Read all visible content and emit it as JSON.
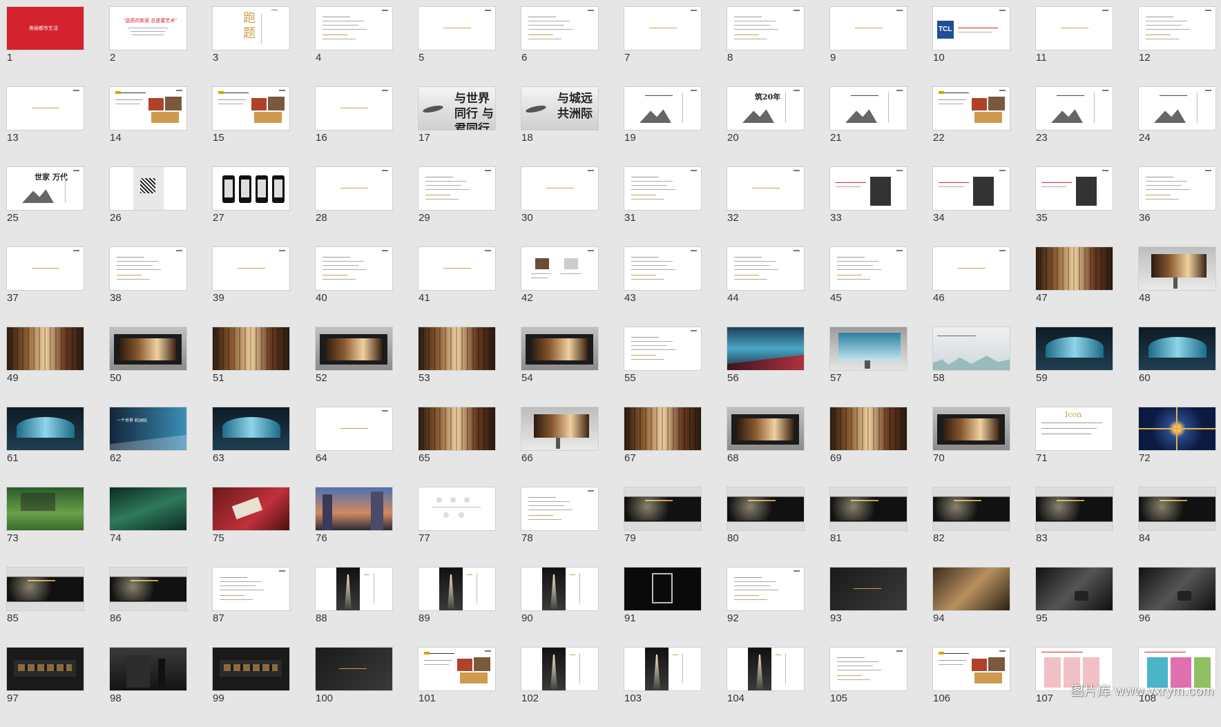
{
  "slides": [
    {
      "n": "1",
      "t": "red",
      "txt": "美丽都市生活"
    },
    {
      "n": "2",
      "t": "quote",
      "txt": "\"品质的新家 总是要艺术\""
    },
    {
      "n": "3",
      "t": "title",
      "txt": "跑 题"
    },
    {
      "n": "4",
      "t": "text"
    },
    {
      "n": "5",
      "t": "gold"
    },
    {
      "n": "6",
      "t": "text"
    },
    {
      "n": "7",
      "t": "gold"
    },
    {
      "n": "8",
      "t": "text"
    },
    {
      "n": "9",
      "t": "gold"
    },
    {
      "n": "10",
      "t": "tcl",
      "txt": "TCL"
    },
    {
      "n": "11",
      "t": "gold"
    },
    {
      "n": "12",
      "t": "text"
    },
    {
      "n": "13",
      "t": "gold"
    },
    {
      "n": "14",
      "t": "photos"
    },
    {
      "n": "15",
      "t": "photos"
    },
    {
      "n": "16",
      "t": "gold"
    },
    {
      "n": "17",
      "t": "ink",
      "txt": "与世界同行 与君同行"
    },
    {
      "n": "18",
      "t": "ink",
      "txt": "与城远 共洲际"
    },
    {
      "n": "19",
      "t": "mtn"
    },
    {
      "n": "20",
      "t": "mtn",
      "txt": "筑20年"
    },
    {
      "n": "21",
      "t": "mtn"
    },
    {
      "n": "22",
      "t": "photos"
    },
    {
      "n": "23",
      "t": "mtn"
    },
    {
      "n": "24",
      "t": "mtn"
    },
    {
      "n": "25",
      "t": "mtn",
      "txt": "世家 万代"
    },
    {
      "n": "26",
      "t": "qr"
    },
    {
      "n": "27",
      "t": "phones"
    },
    {
      "n": "28",
      "t": "gold"
    },
    {
      "n": "29",
      "t": "text"
    },
    {
      "n": "30",
      "t": "gold"
    },
    {
      "n": "31",
      "t": "text"
    },
    {
      "n": "32",
      "t": "gold"
    },
    {
      "n": "33",
      "t": "portrait"
    },
    {
      "n": "34",
      "t": "portrait"
    },
    {
      "n": "35",
      "t": "portrait"
    },
    {
      "n": "36",
      "t": "text"
    },
    {
      "n": "37",
      "t": "gold"
    },
    {
      "n": "38",
      "t": "text"
    },
    {
      "n": "39",
      "t": "gold"
    },
    {
      "n": "40",
      "t": "text"
    },
    {
      "n": "41",
      "t": "gold"
    },
    {
      "n": "42",
      "t": "people"
    },
    {
      "n": "43",
      "t": "text"
    },
    {
      "n": "44",
      "t": "text"
    },
    {
      "n": "45",
      "t": "text"
    },
    {
      "n": "46",
      "t": "gold"
    },
    {
      "n": "47",
      "t": "gbrown"
    },
    {
      "n": "48",
      "t": "billboard"
    },
    {
      "n": "49",
      "t": "gbrown"
    },
    {
      "n": "50",
      "t": "busstop"
    },
    {
      "n": "51",
      "t": "gbrown"
    },
    {
      "n": "52",
      "t": "busstop"
    },
    {
      "n": "53",
      "t": "gbrown"
    },
    {
      "n": "54",
      "t": "busstop"
    },
    {
      "n": "55",
      "t": "text"
    },
    {
      "n": "56",
      "t": "wave"
    },
    {
      "n": "57",
      "t": "wavebb"
    },
    {
      "n": "58",
      "t": "city"
    },
    {
      "n": "59",
      "t": "wavedark"
    },
    {
      "n": "60",
      "t": "wavedark"
    },
    {
      "n": "61",
      "t": "wavedark"
    },
    {
      "n": "62",
      "t": "wavebanner",
      "txt": "一个世界·和洲际"
    },
    {
      "n": "63",
      "t": "wavedark"
    },
    {
      "n": "64",
      "t": "gold"
    },
    {
      "n": "65",
      "t": "gbrown"
    },
    {
      "n": "66",
      "t": "billboard"
    },
    {
      "n": "67",
      "t": "gbrown"
    },
    {
      "n": "68",
      "t": "busstop"
    },
    {
      "n": "69",
      "t": "gbrown"
    },
    {
      "n": "70",
      "t": "busstop"
    },
    {
      "n": "71",
      "t": "icon",
      "txt": "Icon"
    },
    {
      "n": "72",
      "t": "kaleido"
    },
    {
      "n": "73",
      "t": "garden"
    },
    {
      "n": "74",
      "t": "forest"
    },
    {
      "n": "75",
      "t": "craft"
    },
    {
      "n": "76",
      "t": "street"
    },
    {
      "n": "77",
      "t": "icons"
    },
    {
      "n": "78",
      "t": "text"
    },
    {
      "n": "79",
      "t": "lux"
    },
    {
      "n": "80",
      "t": "lux"
    },
    {
      "n": "81",
      "t": "lux"
    },
    {
      "n": "82",
      "t": "lux"
    },
    {
      "n": "83",
      "t": "lux"
    },
    {
      "n": "84",
      "t": "lux"
    },
    {
      "n": "85",
      "t": "lux"
    },
    {
      "n": "86",
      "t": "lux"
    },
    {
      "n": "87",
      "t": "text"
    },
    {
      "n": "88",
      "t": "tunnel"
    },
    {
      "n": "89",
      "t": "tunnel"
    },
    {
      "n": "90",
      "t": "tunnel"
    },
    {
      "n": "91",
      "t": "frame"
    },
    {
      "n": "92",
      "t": "text"
    },
    {
      "n": "93",
      "t": "darklogo"
    },
    {
      "n": "94",
      "t": "cubes"
    },
    {
      "n": "95",
      "t": "leather"
    },
    {
      "n": "96",
      "t": "leather"
    },
    {
      "n": "97",
      "t": "box"
    },
    {
      "n": "98",
      "t": "bag"
    },
    {
      "n": "99",
      "t": "box"
    },
    {
      "n": "100",
      "t": "darklogo"
    },
    {
      "n": "101",
      "t": "photos"
    },
    {
      "n": "102",
      "t": "tunnel"
    },
    {
      "n": "103",
      "t": "tunnel"
    },
    {
      "n": "104",
      "t": "tunnel"
    },
    {
      "n": "105",
      "t": "text"
    },
    {
      "n": "106",
      "t": "photos"
    },
    {
      "n": "107",
      "t": "redcards"
    },
    {
      "n": "108",
      "t": "colorcards"
    }
  ],
  "watermark": "图片库 www.vxrym.com",
  "colors": {
    "bg": "#e6e6e6",
    "red": "#d4232f",
    "gold": "#c9a045"
  }
}
